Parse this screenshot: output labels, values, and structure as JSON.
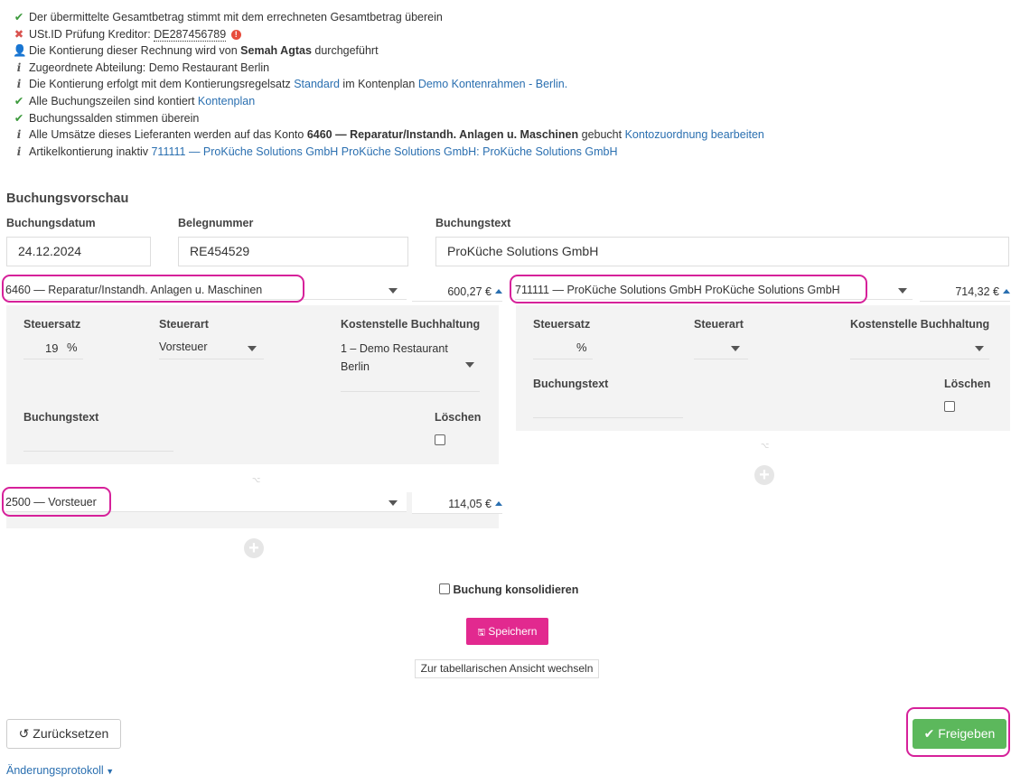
{
  "info": {
    "item1": "Der übermittelte Gesamtbetrag stimmt mit dem errechneten Gesamtbetrag überein",
    "item2_prefix": "USt.ID Prüfung Kreditor: ",
    "item2_vat": "DE287456789",
    "item2_badge": "!",
    "item3_prefix": "Die Kontierung dieser Rechnung wird von ",
    "item3_name": "Semah Agtas",
    "item3_suffix": " durchgeführt",
    "item4": "Zugeordnete Abteilung: Demo Restaurant Berlin",
    "item5_prefix": "Die Kontierung erfolgt mit dem Kontierungsregelsatz ",
    "item5_link1": "Standard",
    "item5_mid": " im Kontenplan ",
    "item5_link2": "Demo Kontenrahmen - Berlin.",
    "item6_prefix": "Alle Buchungszeilen sind kontiert ",
    "item6_link": "Kontenplan",
    "item7": "Buchungssalden stimmen überein",
    "item8_prefix": "Alle Umsätze dieses Lieferanten werden auf das Konto ",
    "item8_bold": "6460 — Reparatur/Instandh. Anlagen u. Maschinen",
    "item8_mid": " gebucht ",
    "item8_link": "Kontozuordnung bearbeiten",
    "item9_prefix": "Artikelkontierung inaktiv ",
    "item9_link": "711111 — ProKüche Solutions GmbH ProKüche Solutions GmbH: ProKüche Solutions GmbH"
  },
  "preview": {
    "title": "Buchungsvorschau",
    "date_label": "Buchungsdatum",
    "date_value": "24.12.2024",
    "doc_label": "Belegnummer",
    "doc_value": "RE454529",
    "text_label": "Buchungstext",
    "text_value": "ProKüche Solutions GmbH"
  },
  "lines": {
    "left_account": "6460 — Reparatur/Instandh. Anlagen u. Maschinen",
    "left_amount": "600,27 €",
    "right_account": "711111 — ProKüche Solutions GmbH ProKüche Solutions GmbH",
    "right_amount": "714,32 €",
    "tax_account": "2500 — Vorsteuer",
    "tax_amount": "114,05 €"
  },
  "left_panel": {
    "steuersatz_label": "Steuersatz",
    "steuersatz_value": "19",
    "percent": "%",
    "steuerart_label": "Steuerart",
    "steuerart_value": "Vorsteuer",
    "kostenstelle_label": "Kostenstelle Buchhaltung",
    "kostenstelle_value_line1": "1 – Demo Restaurant",
    "kostenstelle_value_line2": "Berlin",
    "buchungstext_label": "Buchungstext",
    "loeschen_label": "Löschen"
  },
  "right_panel": {
    "steuersatz_label": "Steuersatz",
    "percent": "%",
    "steuerart_label": "Steuerart",
    "kostenstelle_label": "Kostenstelle Buchhaltung",
    "buchungstext_label": "Buchungstext",
    "loeschen_label": "Löschen"
  },
  "actions": {
    "consolidate_label": "Buchung konsolidieren",
    "save_label": "Speichern",
    "table_view_label": "Zur tabellarischen Ansicht wechseln",
    "reset_label": "Zurücksetzen",
    "release_label": "Freigeben",
    "changelog_label": "Änderungsprotokoll"
  },
  "colors": {
    "highlight": "#d6219a",
    "save_button": "#e2298f",
    "release_button": "#5cb85c",
    "link": "#2a6fb0"
  }
}
